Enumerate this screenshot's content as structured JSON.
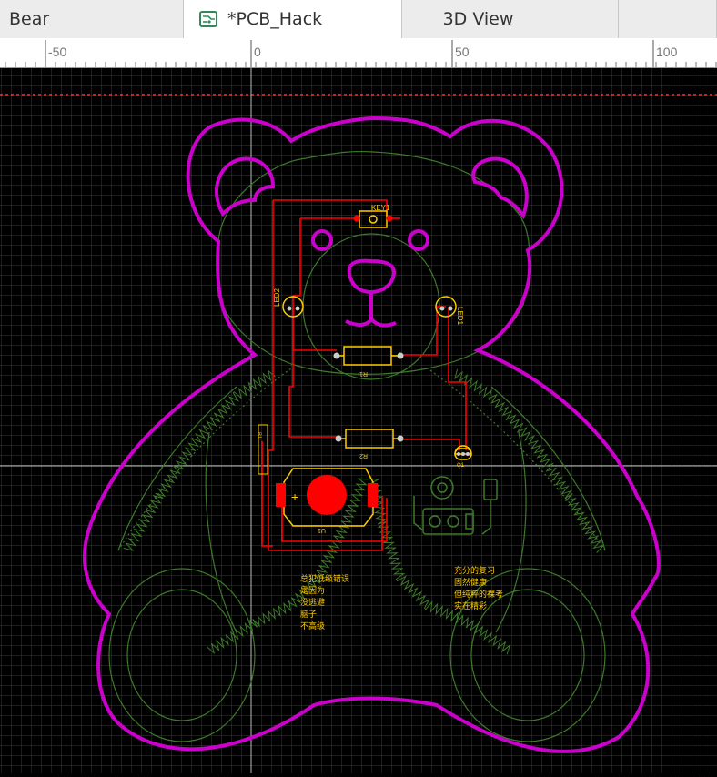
{
  "tabs": [
    {
      "label": "Bear"
    },
    {
      "label": "*PCB_Hack",
      "icon": "pcb-board-icon",
      "active": true
    },
    {
      "label": "3D View"
    }
  ],
  "ruler": {
    "labels": [
      "-50",
      "0",
      "50",
      "100"
    ]
  },
  "components": {
    "key": "KEY1",
    "led1": "LED1",
    "led2": "LED2",
    "r1": "R1",
    "r2": "R2",
    "battery_plus": "+",
    "u1": "U1",
    "q1": "Q1",
    "spk": "B1"
  },
  "silkscreen_left": [
    "总犯低级错误",
    "是因为",
    "没逃避",
    "脑子",
    "不高级"
  ],
  "silkscreen_right": [
    "充分的复习",
    "固然健康",
    "但纯粹的裸考",
    "实在精彩"
  ],
  "colors": {
    "board_outline": "#cc00cc",
    "top_copper": "#ff0000",
    "silkscreen": "#ffcc00",
    "inner_layer": "#3d7a2a",
    "grid": "#3a3a3a",
    "background": "#000000"
  }
}
